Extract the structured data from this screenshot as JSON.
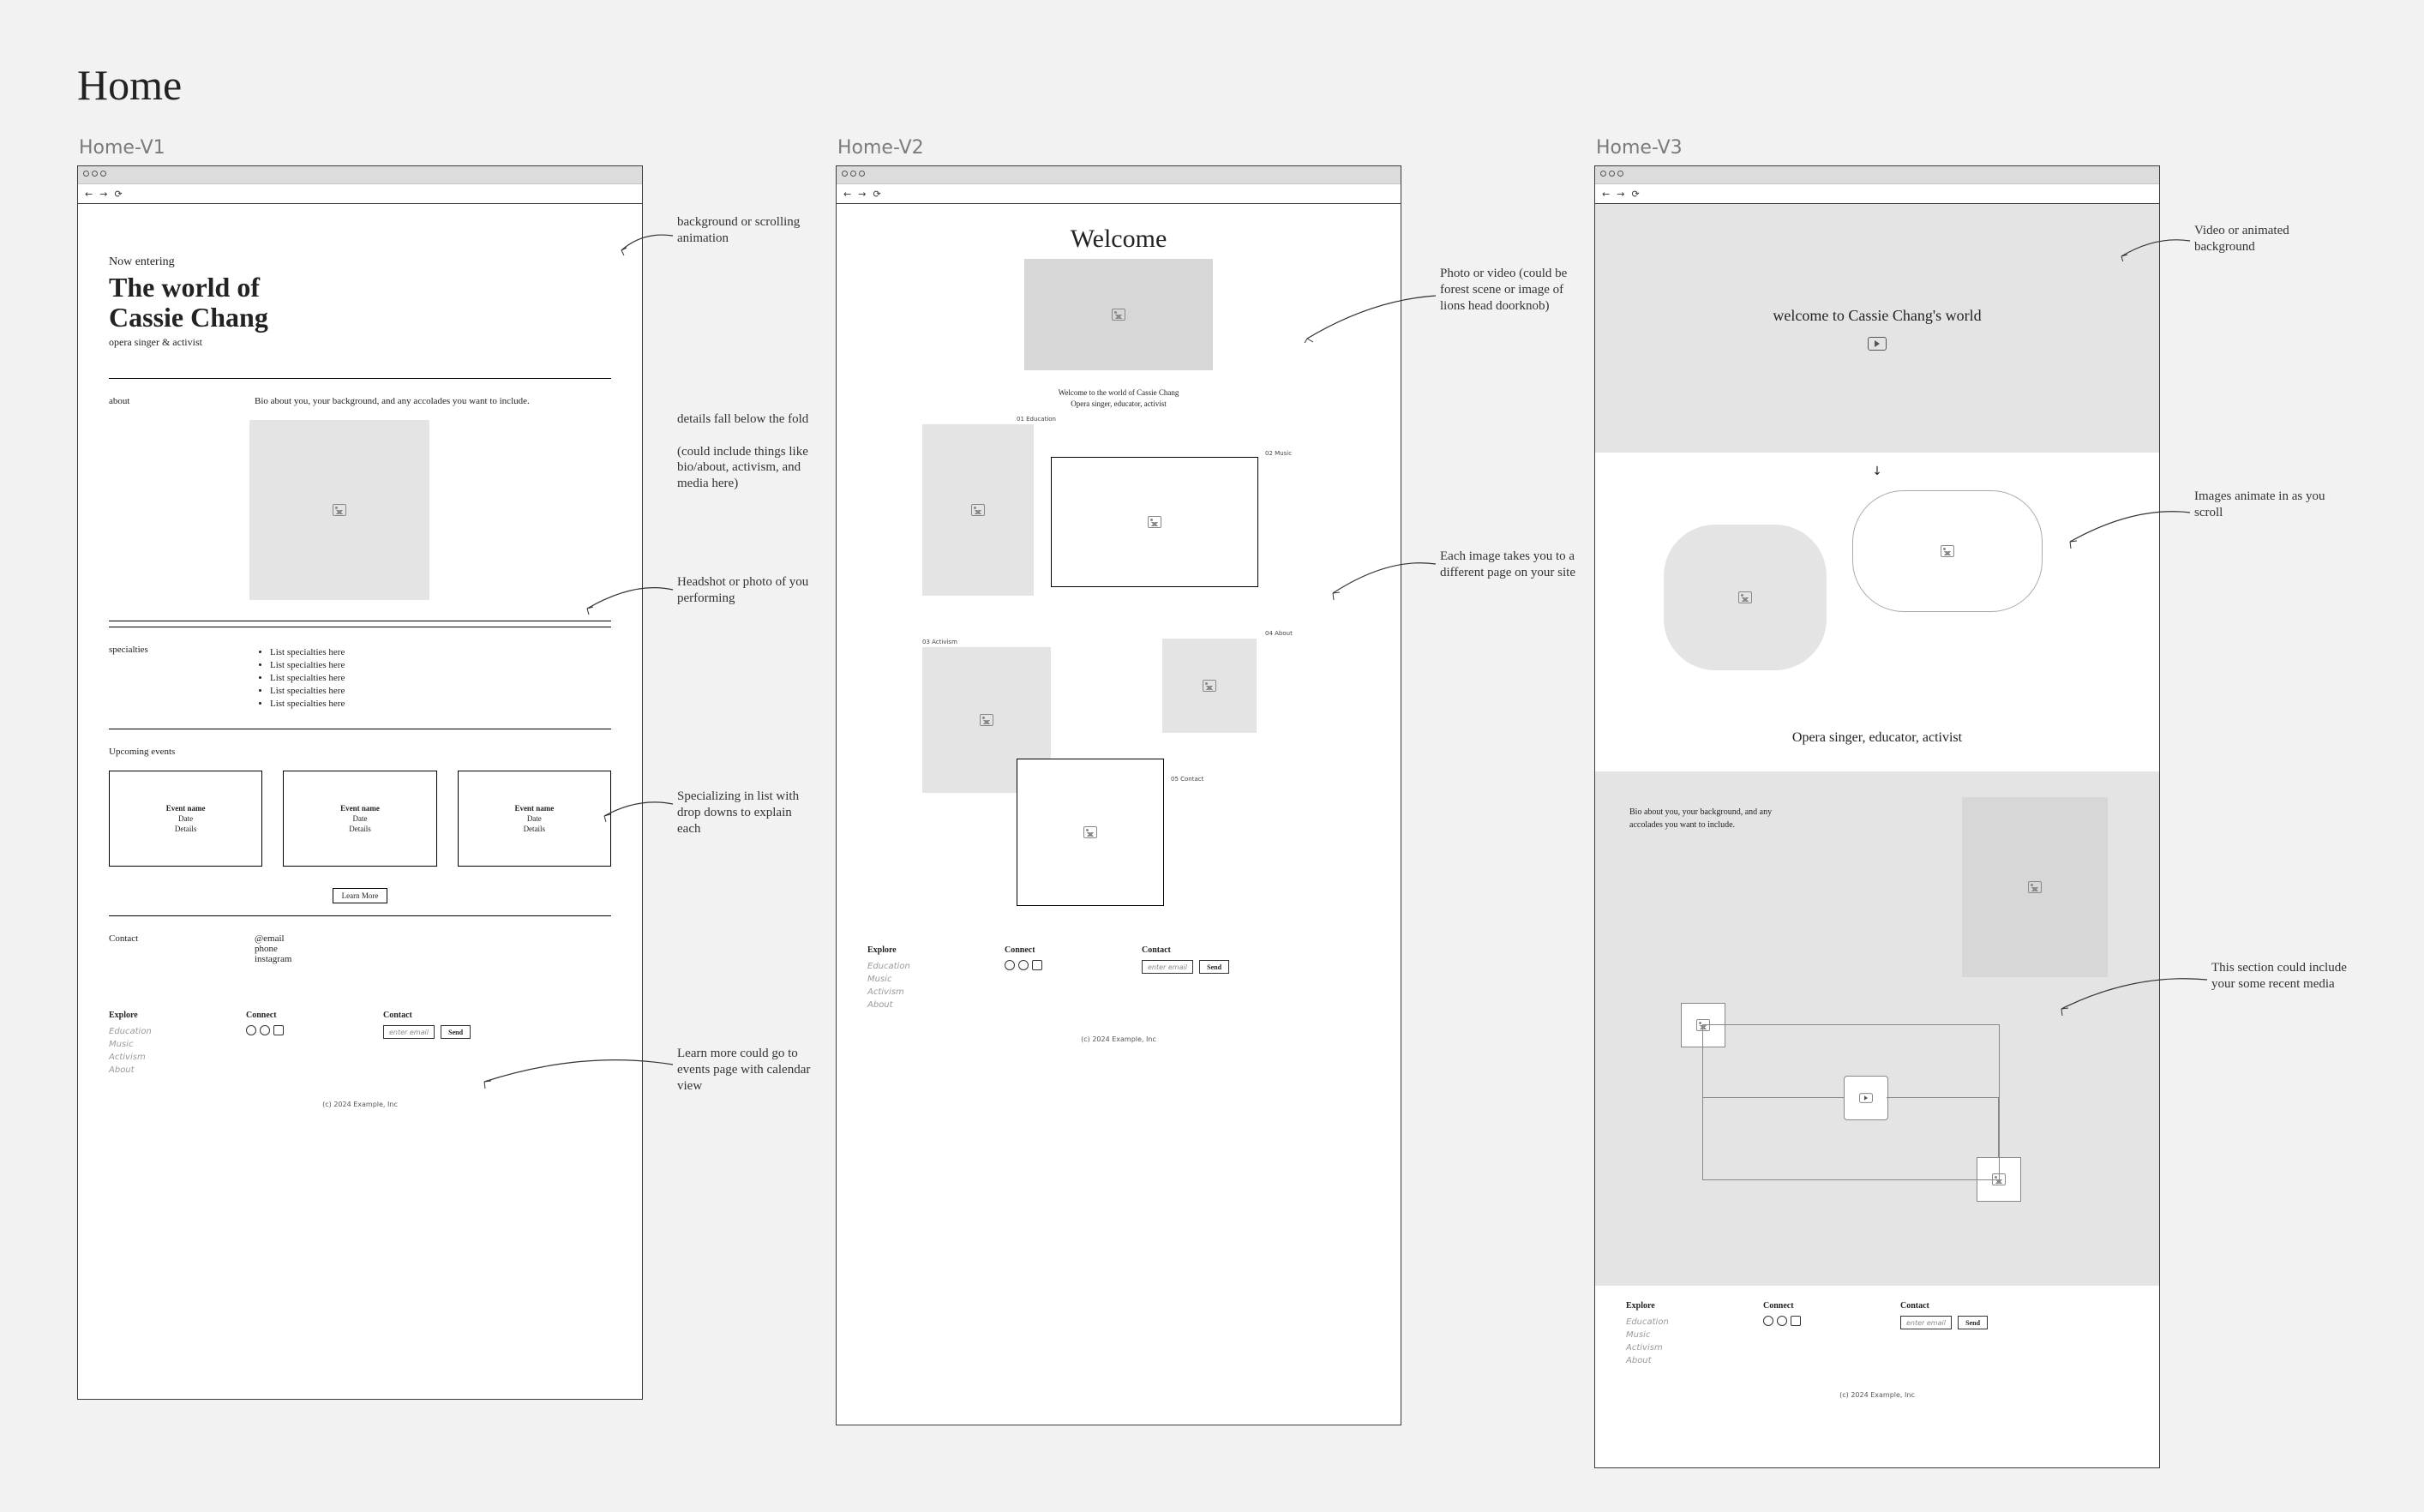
{
  "page_title": "Home",
  "variants": {
    "v1": {
      "label": "Home-V1"
    },
    "v2": {
      "label": "Home-V2"
    },
    "v3": {
      "label": "Home-V3"
    }
  },
  "v1": {
    "hero": {
      "pre": "Now entering",
      "main_line1": "The world of",
      "main_line2": "Cassie Chang",
      "sub": "opera singer & activist"
    },
    "about": {
      "label": "about",
      "body": "Bio about you, your background, and any accolades you want to include."
    },
    "specialties": {
      "label": "specialties",
      "items": [
        "List specialties here",
        "List specialties here",
        "List specialties here",
        "List specialties here",
        "List specialties here"
      ]
    },
    "events": {
      "label": "Upcoming events",
      "cards": [
        {
          "name": "Event name",
          "date": "Date",
          "details": "Details"
        },
        {
          "name": "Event name",
          "date": "Date",
          "details": "Details"
        },
        {
          "name": "Event name",
          "date": "Date",
          "details": "Details"
        }
      ],
      "learn_more": "Learn More"
    },
    "contact": {
      "label": "Contact",
      "email": "@email",
      "phone": "phone",
      "instagram": "instagram"
    }
  },
  "v2": {
    "welcome": "Welcome",
    "hero_text_line1": "Welcome to the world of Cassie Chang",
    "hero_text_line2": "Opera singer, educator, activist",
    "tiles": {
      "t1": "01 Education",
      "t2": "02 Music",
      "t3": "03 Activism",
      "t4": "04 About",
      "t5": "05 Contact"
    }
  },
  "v3": {
    "hero_text": "welcome to Cassie Chang's world",
    "tag": "Opera singer, educator, activist",
    "bio": "Bio about you, your background, and any accolades you want to include."
  },
  "footer": {
    "explore": {
      "title": "Explore",
      "links": [
        "Education",
        "Music",
        "Activism",
        "About"
      ]
    },
    "connect": {
      "title": "Connect"
    },
    "contact": {
      "title": "Contact",
      "placeholder": "enter email",
      "button": "Send"
    },
    "copyright": "(c) 2024 Example, Inc"
  },
  "annotations": {
    "v1": {
      "a1": "background or scrolling animation",
      "a2": "details fall below the fold\n\n(could include things like bio/about, activism, and media here)",
      "a3": "Headshot or photo of you performing",
      "a4": "Specializing in list with drop downs to explain each",
      "a5": "Learn more could go to events page with calendar view"
    },
    "v2": {
      "a1": "Photo or video (could be forest scene or image of lions head doorknob)",
      "a2": "Each image takes you to a different page on your site"
    },
    "v3": {
      "a1": "Video or animated background",
      "a2": "Images animate in as you scroll",
      "a3": "This section could include your some recent media"
    }
  }
}
